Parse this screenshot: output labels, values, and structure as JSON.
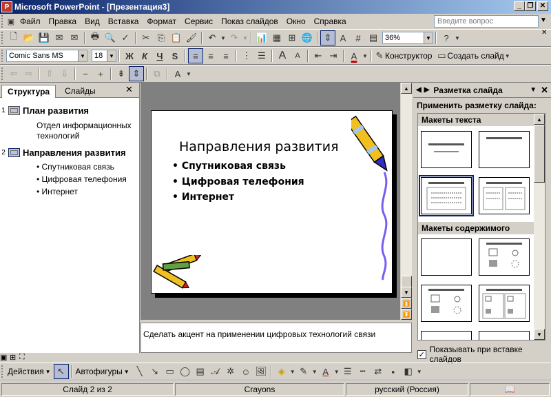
{
  "window": {
    "title": "Microsoft PowerPoint - [Презентация3]"
  },
  "menu": [
    "Файл",
    "Правка",
    "Вид",
    "Вставка",
    "Формат",
    "Сервис",
    "Показ слайдов",
    "Окно",
    "Справка"
  ],
  "ask": {
    "placeholder": "Введите вопрос"
  },
  "standard_toolbar": {
    "zoom": "36%"
  },
  "format_toolbar": {
    "font": "Comic Sans MS",
    "size": "18",
    "bold": "Ж",
    "italic": "К",
    "underline": "Ч",
    "shadow": "S",
    "designer": "Конструктор",
    "new_slide": "Создать слайд"
  },
  "left_pane": {
    "tabs": [
      "Структура",
      "Слайды"
    ],
    "slides": [
      {
        "num": "1",
        "title": "План развития",
        "text": [
          "Отдел информационных",
          "технологий"
        ]
      },
      {
        "num": "2",
        "title": "Направления развития",
        "bullets": [
          "Спутниковая связь",
          "Цифровая телефония",
          "Интернет"
        ]
      }
    ]
  },
  "slide": {
    "title": "Направления развития",
    "bullets": [
      "Спутниковая связь",
      "Цифровая телефония",
      "Интернет"
    ]
  },
  "notes": "Сделать акцент на применении цифровых технологий связи",
  "task_pane": {
    "title": "Разметка слайда",
    "apply": "Применить разметку слайда:",
    "section_text": "Макеты текста",
    "section_content": "Макеты содержимого",
    "show_on_insert": "Показывать при вставке слайдов"
  },
  "drawing_toolbar": {
    "actions": "Действия",
    "autoshapes": "Автофигуры"
  },
  "status": {
    "slide": "Слайд 2 из 2",
    "design": "Crayons",
    "lang": "русский (Россия)"
  },
  "colors": {
    "title_bar": "#0a246a",
    "slide_bg": "#ffffff",
    "workspace": "#808080",
    "accent_pencil": "#f0c020"
  }
}
